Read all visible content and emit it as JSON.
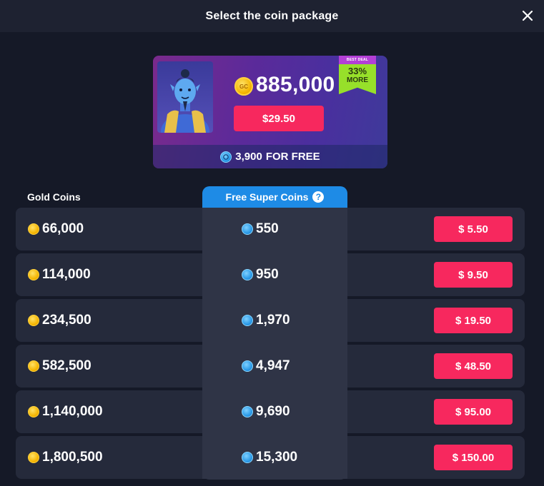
{
  "header": {
    "title": "Select the coin package",
    "close_icon": "close-icon"
  },
  "featured_deal": {
    "coin_icon": "gold-coin-icon",
    "coin_icon_label": "GC",
    "amount": "885,000",
    "price": "$29.50",
    "badge_top": "BEST DEAL",
    "badge_percent": "33%",
    "badge_more": "MORE",
    "free_icon": "super-coin-icon",
    "free_amount": "3,900",
    "free_label": "FOR FREE",
    "colors": {
      "price_button": "#f7285e",
      "badge": "#97e02a",
      "badge_top": "#b33fd6"
    }
  },
  "table": {
    "gold_header": "Gold Coins",
    "super_header": "Free Super Coins",
    "help_icon": "?",
    "rows": [
      {
        "gold": "66,000",
        "super": "550",
        "price": "$ 5.50"
      },
      {
        "gold": "114,000",
        "super": "950",
        "price": "$ 9.50"
      },
      {
        "gold": "234,500",
        "super": "1,970",
        "price": "$ 19.50"
      },
      {
        "gold": "582,500",
        "super": "4,947",
        "price": "$ 48.50"
      },
      {
        "gold": "1,140,000",
        "super": "9,690",
        "price": "$ 95.00"
      },
      {
        "gold": "1,800,500",
        "super": "15,300",
        "price": "$ 150.00"
      }
    ]
  },
  "colors": {
    "background": "#161a27",
    "header": "#1e2231",
    "accent_blue": "#1e8be6",
    "price_button": "#f7285e"
  }
}
